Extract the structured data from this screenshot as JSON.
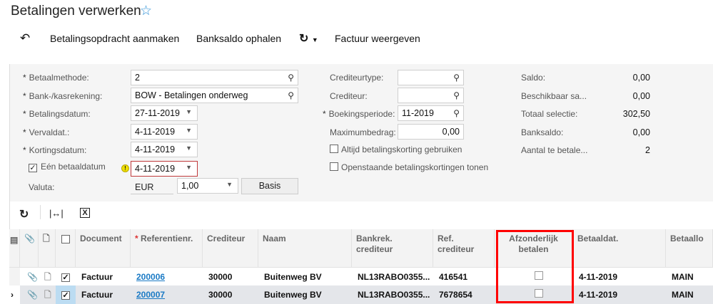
{
  "title": "Betalingen verwerken",
  "toolbar": {
    "create": "Betalingsopdracht aanmaken",
    "fetch": "Banksaldo ophalen",
    "show": "Factuur weergeven"
  },
  "form": {
    "betaalmethode": {
      "label": "Betaalmethode:",
      "value": "2"
    },
    "bank": {
      "label": "Bank-/kasrekening:",
      "value": "BOW - Betalingen onderweg"
    },
    "betalingsdatum": {
      "label": "Betalingsdatum:",
      "value": "27-11-2019"
    },
    "vervaldat": {
      "label": "Vervaldat.:",
      "value": "4-11-2019"
    },
    "kortingsdatum": {
      "label": "Kortingsdatum:",
      "value": "4-11-2019"
    },
    "een": {
      "label": "Eén betaaldatum",
      "value": "4-11-2019",
      "checked": true
    },
    "valuta": {
      "label": "Valuta:",
      "value": "EUR",
      "rate": "1,00",
      "button": "Basis"
    },
    "crediteurtype": {
      "label": "Crediteurtype:",
      "value": ""
    },
    "crediteur": {
      "label": "Crediteur:",
      "value": ""
    },
    "boekingsperiode": {
      "label": "Boekingsperiode:",
      "value": "11-2019"
    },
    "maximumbedrag": {
      "label": "Maximumbedrag:",
      "value": "0,00"
    },
    "altijd": {
      "label": "Altijd betalingskorting gebruiken",
      "checked": false
    },
    "openstaande": {
      "label": "Openstaande betalingskortingen tonen",
      "checked": false
    },
    "saldo": {
      "label": "Saldo:",
      "value": "0,00"
    },
    "beschikbaar": {
      "label": "Beschikbaar sa...",
      "value": "0,00"
    },
    "totaal": {
      "label": "Totaal selectie:",
      "value": "302,50"
    },
    "banksaldo": {
      "label": "Banksaldo:",
      "value": "0,00"
    },
    "aantal": {
      "label": "Aantal te betale...",
      "value": "2"
    }
  },
  "grid": {
    "headers": [
      "Document",
      "Referentienr.",
      "Crediteur",
      "Naam",
      "Bankrek. crediteur",
      "Ref. crediteur",
      "Afzonderlijk betalen",
      "Betaaldat.",
      "Betaallo"
    ],
    "rows": [
      {
        "document": "Factuur",
        "ref": "200006",
        "crediteur": "30000",
        "naam": "Buitenweg BV",
        "bankrek": "NL13RABO0355...",
        "refcred": "416541",
        "afz": false,
        "betaaldat": "4-11-2019",
        "betaallo": "MAIN",
        "selected": true
      },
      {
        "document": "Factuur",
        "ref": "200007",
        "crediteur": "30000",
        "naam": "Buitenweg BV",
        "bankrek": "NL13RABO0355...",
        "refcred": "7678654",
        "afz": false,
        "betaaldat": "4-11-2019",
        "betaallo": "MAIN",
        "selected": true
      }
    ]
  },
  "colors": {
    "accent": "#2a8fd6",
    "highlight": "#ff0000",
    "rowActive": "#e4e6ea"
  }
}
